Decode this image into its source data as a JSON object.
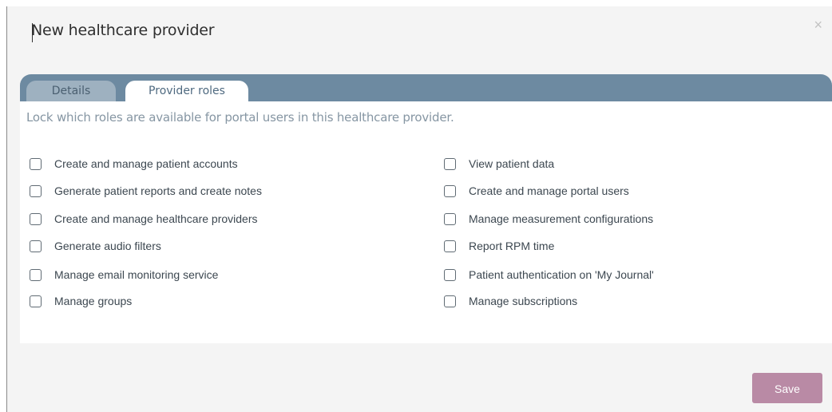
{
  "dialog": {
    "title": "New healthcare provider",
    "close_label": "×"
  },
  "tabs": [
    {
      "label": "Details",
      "active": false
    },
    {
      "label": "Provider roles",
      "active": true
    }
  ],
  "panel": {
    "description": "Lock which roles are available for portal users in this healthcare provider."
  },
  "roles": {
    "left": [
      {
        "label": "Create and manage patient accounts",
        "checked": false
      },
      {
        "label": "Generate patient reports and create notes",
        "checked": false
      },
      {
        "label": "Create and manage healthcare providers",
        "checked": false
      },
      {
        "label": "Generate audio filters",
        "checked": false
      },
      {
        "label": "Manage email monitoring service",
        "checked": false
      },
      {
        "label": "Manage groups",
        "checked": false
      }
    ],
    "right": [
      {
        "label": "View patient data",
        "checked": false
      },
      {
        "label": "Create and manage portal users",
        "checked": false
      },
      {
        "label": "Manage measurement configurations",
        "checked": false
      },
      {
        "label": "Report RPM time",
        "checked": false
      },
      {
        "label": "Patient authentication on 'My Journal'",
        "checked": false
      },
      {
        "label": "Manage subscriptions",
        "checked": false
      }
    ]
  },
  "footer": {
    "save_label": "Save"
  },
  "colors": {
    "tab_bar": "#6d8aa1",
    "save_button": "#b98aa5",
    "dialog_background": "#f4f4f4"
  }
}
